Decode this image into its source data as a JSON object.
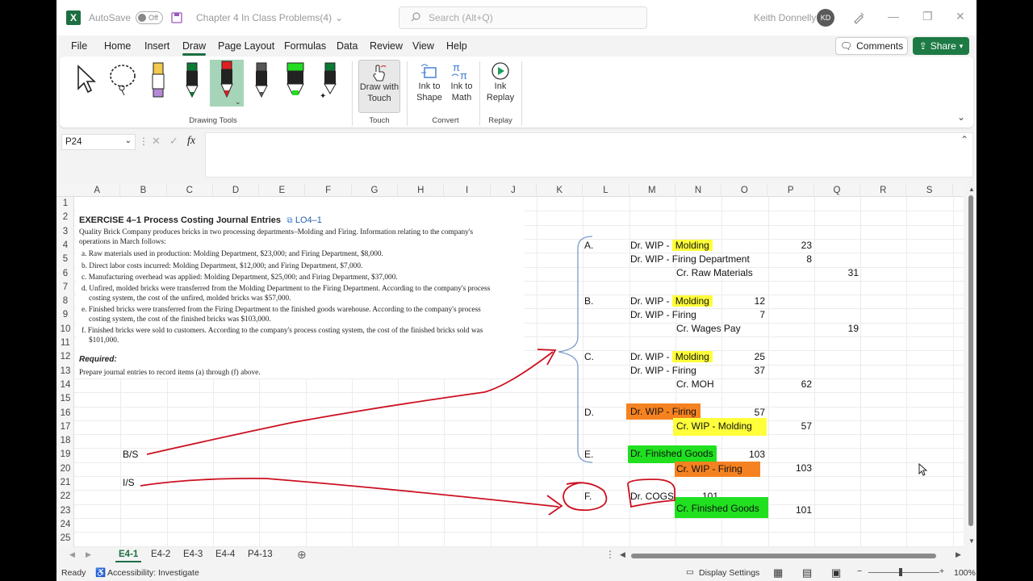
{
  "titlebar": {
    "autosave_label": "AutoSave",
    "autosave_state": "Off",
    "doc_title": "Chapter 4 In Class Problems(4)",
    "search_placeholder": "Search (Alt+Q)",
    "user_name": "Keith Donnelly",
    "user_initials": "KD"
  },
  "menu": {
    "items": [
      "File",
      "Home",
      "Insert",
      "Draw",
      "Page Layout",
      "Formulas",
      "Data",
      "Review",
      "View",
      "Help"
    ],
    "active": "Draw",
    "comments_label": "Comments",
    "share_label": "Share"
  },
  "ribbon": {
    "groups": {
      "drawing_tools": "Drawing Tools",
      "touch": "Touch",
      "convert": "Convert",
      "replay": "Replay"
    },
    "buttons": {
      "draw_with_touch_1": "Draw with",
      "draw_with_touch_2": "Touch",
      "ink_to_shape_1": "Ink to",
      "ink_to_shape_2": "Shape",
      "ink_to_math_1": "Ink to",
      "ink_to_math_2": "Math",
      "ink_replay_1": "Ink",
      "ink_replay_2": "Replay"
    },
    "pen_colors": [
      "#f2c94c",
      "#0a7a35",
      "#e02020",
      "#555555",
      "#22dd22",
      "#0a7a35"
    ]
  },
  "formula_bar": {
    "name_box": "P24",
    "fx": "fx",
    "content": ""
  },
  "grid": {
    "columns": [
      "A",
      "B",
      "C",
      "D",
      "E",
      "F",
      "G",
      "H",
      "I",
      "J",
      "K",
      "L",
      "M",
      "N",
      "O",
      "P",
      "Q",
      "R",
      "S"
    ],
    "rows": [
      "1",
      "2",
      "3",
      "4",
      "5",
      "6",
      "7",
      "8",
      "9",
      "10",
      "11",
      "12",
      "13",
      "14",
      "15",
      "16",
      "17",
      "18",
      "19",
      "20",
      "21",
      "22",
      "23",
      "24",
      "25"
    ]
  },
  "exercise": {
    "title": "EXERCISE 4–1 Process Costing Journal Entries",
    "lo": "LO4–1",
    "intro_1": "Quality Brick Company produces bricks in two processing departments–Molding and Firing. Information relating to the company's",
    "intro_2": "operations in March follows:",
    "a": "a. Raw materials used in production: Molding Department, $23,000; and Firing Department, $8,000.",
    "b": "b. Direct labor costs incurred: Molding Department, $12,000; and Firing Department, $7,000.",
    "c": "c. Manufacturing overhead was applied: Molding Department, $25,000; and Firing Department, $37,000.",
    "d_1": "d. Unfired, molded bricks were transferred from the Molding Department to the Firing Department. According to the company's process",
    "d_2": "costing system, the cost of the unfired, molded bricks was $57,000.",
    "e_1": "e. Finished bricks were transferred from the Firing Department to the finished goods warehouse. According to the company's process",
    "e_2": "costing system, the cost of the finished bricks was $103,000.",
    "f_1": "f. Finished bricks were sold to customers. According to the company's process costing system, the cost of the finished bricks sold was",
    "f_2": "$101,000.",
    "required": "Required:",
    "required_text": "Prepare journal entries to record items (a) through (f) above."
  },
  "annotations": {
    "bs": "B/S",
    "is": "I/S"
  },
  "journal": {
    "A": "A.",
    "B": "B.",
    "C": "C.",
    "D": "D.",
    "E": "E.",
    "F": "F.",
    "dr_wip": "Dr. WIP - ",
    "molding": "Molding",
    "a_r2": "Dr. WIP - Firing Department",
    "a_r3": "Cr. Raw Materials",
    "a_v1": "23",
    "a_v2": "8",
    "a_v3": "31",
    "b_r2": "Dr. WIP - Firing",
    "b_r3": "Cr. Wages Pay",
    "b_v1": "12",
    "b_v2": "7",
    "b_v3": "19",
    "c_r2": "Dr. WIP - Firing",
    "c_r3": "Cr. MOH",
    "c_v1": "25",
    "c_v2": "37",
    "c_v3": "62",
    "d_r1": "Dr. WIP - Firing",
    "d_r2": "Cr. WIP - Molding",
    "d_v1": "57",
    "d_v2": "57",
    "e_r1": "Dr. Finished Goods",
    "e_r2": "Cr. WIP - Firing",
    "e_v1": "103",
    "e_v2": "103",
    "f_r1": "Dr. COGS",
    "f_r2": "Cr. Finished Goods",
    "f_v1": "101",
    "f_v2": "101"
  },
  "sheets": [
    "E4-1",
    "E4-2",
    "E4-3",
    "E4-4",
    "P4-13"
  ],
  "active_sheet": "E4-1",
  "status": {
    "ready": "Ready",
    "accessibility": "Accessibility: Investigate",
    "display_settings": "Display Settings",
    "zoom": "100%"
  },
  "colors": {
    "excel_green": "#1d6f42",
    "highlight_yellow": "#ffff3a",
    "highlight_orange": "#f58220",
    "highlight_green": "#20e020",
    "ink_red": "#cc1020",
    "bracket_blue": "#7a9cc8"
  }
}
